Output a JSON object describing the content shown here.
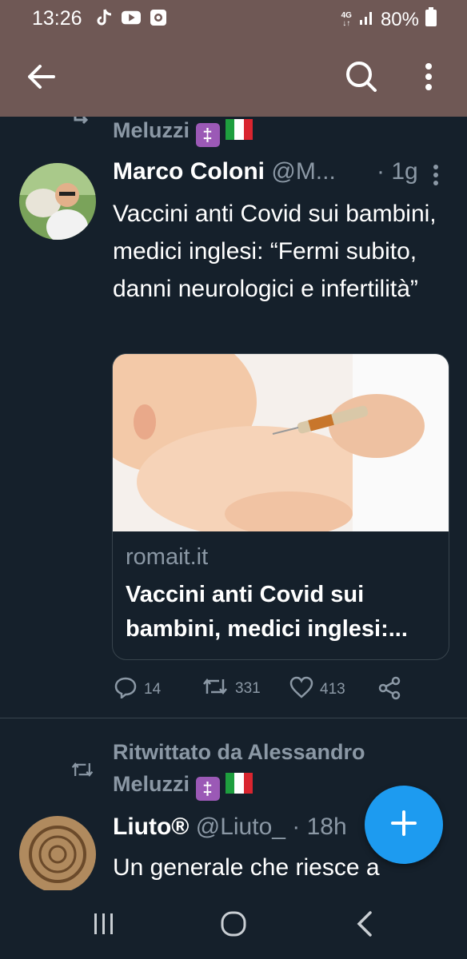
{
  "status_bar": {
    "time": "13:26",
    "network": "4G",
    "battery": "80%",
    "app_icons": [
      "tiktok-icon",
      "youtube-icon",
      "screen-recorder-icon"
    ]
  },
  "toolbar": {
    "back_icon": "arrow-left-icon",
    "search_icon": "search-icon",
    "more_icon": "vertical-dots-icon"
  },
  "feed": {
    "tweets": [
      {
        "retweeted_by_partial": "Meluzzi",
        "author_name": "Marco Coloni",
        "author_handle": "@M...",
        "time": "· 1g",
        "text": "Vaccini anti Covid sui bambini, medici inglesi: “Fermi subito, danni neurologici e infertilità”",
        "card": {
          "domain": "romait.it",
          "title": "Vaccini anti Covid sui bambini, medici inglesi:..."
        },
        "replies": "14",
        "retweets": "331",
        "likes": "413"
      },
      {
        "retweeted_label": "Ritwittato da Alessandro",
        "retweeted_by_line2": "Meluzzi",
        "author_name": "Liuto®",
        "author_handle": "@Liuto_",
        "time": "· 18h",
        "text": "Un generale che riesce a"
      }
    ]
  },
  "fab": {
    "icon": "plus-icon"
  },
  "nav": {
    "items": [
      "recents-icon",
      "home-icon",
      "back-icon"
    ]
  },
  "colors": {
    "background": "#15202b",
    "header": "#6f5855",
    "accent": "#1d9bf0",
    "secondary_text": "#8b98a5"
  }
}
